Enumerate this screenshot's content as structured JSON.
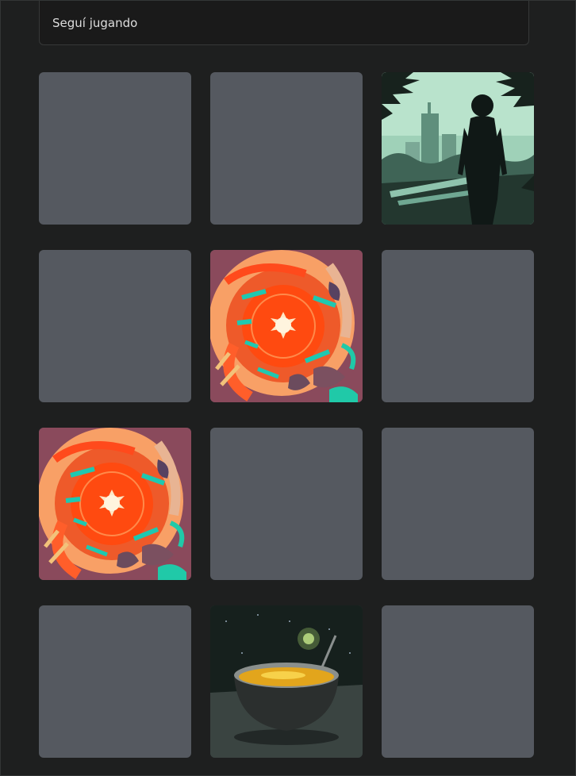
{
  "banner": {
    "text": "Seguí jugando"
  },
  "board": {
    "rows": 4,
    "cols": 3,
    "cards": [
      {
        "state": "hidden"
      },
      {
        "state": "hidden"
      },
      {
        "state": "revealed",
        "image": "silhouette-city-forest"
      },
      {
        "state": "hidden"
      },
      {
        "state": "revealed",
        "image": "orange-abstract-burst"
      },
      {
        "state": "hidden"
      },
      {
        "state": "revealed",
        "image": "orange-abstract-burst"
      },
      {
        "state": "hidden"
      },
      {
        "state": "hidden"
      },
      {
        "state": "hidden"
      },
      {
        "state": "revealed",
        "image": "soup-bowl-space"
      },
      {
        "state": "hidden"
      }
    ]
  },
  "colors": {
    "hidden_card": "#555960",
    "background": "#1e1f1f"
  }
}
